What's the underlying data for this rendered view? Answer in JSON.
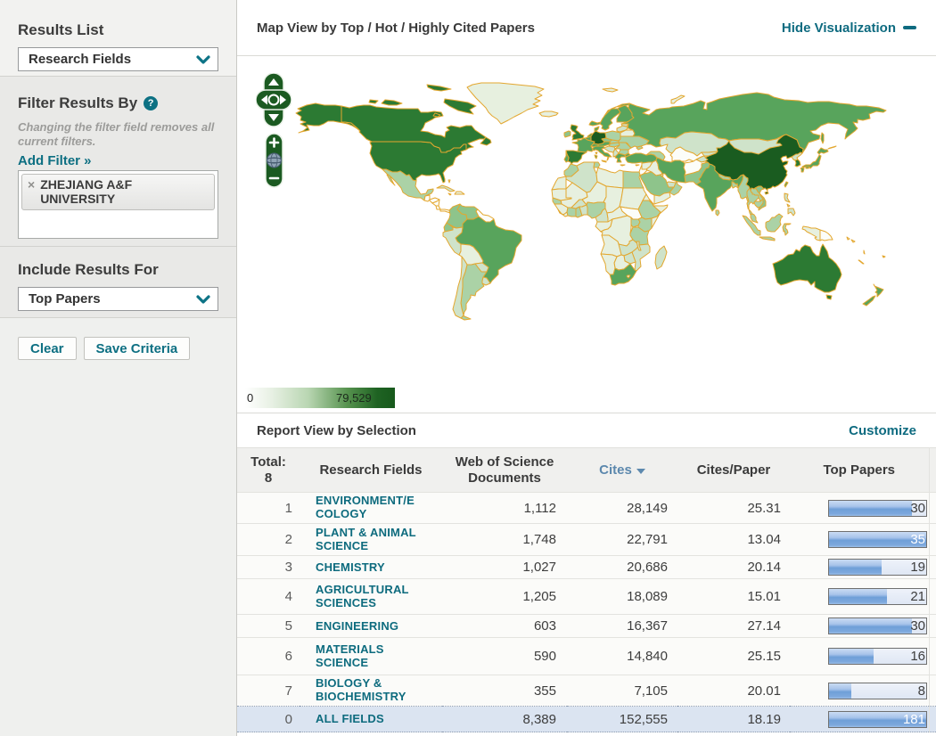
{
  "sidebar": {
    "results_list": {
      "label": "Results List",
      "value": "Research Fields"
    },
    "filter": {
      "heading": "Filter Results By",
      "help_icon": "?",
      "note": "Changing the filter field removes all current filters.",
      "add_filter": "Add Filter »",
      "chip": {
        "remove_icon": "×",
        "text": "ZHEJIANG A&F UNIVERSITY"
      }
    },
    "include": {
      "heading": "Include Results For",
      "value": "Top Papers"
    },
    "buttons": {
      "clear": "Clear",
      "save": "Save Criteria"
    }
  },
  "map": {
    "title": "Map View by Top / Hot / Highly Cited Papers",
    "hide_label": "Hide Visualization",
    "legend": {
      "min": "0",
      "max": "79,529"
    }
  },
  "report": {
    "title": "Report View by Selection",
    "customize_label": "Customize",
    "table": {
      "headers": {
        "total_line1": "Total:",
        "total_line2": "8",
        "fields": "Research Fields",
        "documents": "Web of Science Documents",
        "cites": "Cites",
        "cites_paper": "Cites/Paper",
        "top_papers": "Top Papers"
      },
      "rows": [
        {
          "rank": "1",
          "field": "ENVIRONMENT/ECOLOGY",
          "documents": "1,112",
          "cites": "28,149",
          "cites_per_paper": "25.31",
          "top_papers": 30,
          "highlight": false
        },
        {
          "rank": "2",
          "field": "PLANT & ANIMAL SCIENCE",
          "documents": "1,748",
          "cites": "22,791",
          "cites_per_paper": "13.04",
          "top_papers": 35,
          "highlight": false
        },
        {
          "rank": "3",
          "field": "CHEMISTRY",
          "documents": "1,027",
          "cites": "20,686",
          "cites_per_paper": "20.14",
          "top_papers": 19,
          "highlight": false
        },
        {
          "rank": "4",
          "field": "AGRICULTURAL SCIENCES",
          "documents": "1,205",
          "cites": "18,089",
          "cites_per_paper": "15.01",
          "top_papers": 21,
          "highlight": false
        },
        {
          "rank": "5",
          "field": "ENGINEERING",
          "documents": "603",
          "cites": "16,367",
          "cites_per_paper": "27.14",
          "top_papers": 30,
          "highlight": false
        },
        {
          "rank": "6",
          "field": "MATERIALS SCIENCE",
          "documents": "590",
          "cites": "14,840",
          "cites_per_paper": "25.15",
          "top_papers": 16,
          "highlight": false
        },
        {
          "rank": "7",
          "field": "BIOLOGY & BIOCHEMISTRY",
          "documents": "355",
          "cites": "7,105",
          "cites_per_paper": "20.01",
          "top_papers": 8,
          "highlight": false
        },
        {
          "rank": "0",
          "field": "ALL FIELDS",
          "documents": "8,389",
          "cites": "152,555",
          "cites_per_paper": "18.19",
          "top_papers": 181,
          "highlight": true
        }
      ]
    }
  },
  "colors": {
    "teal": "#0d6f82",
    "cites_header": "#5c88ad",
    "bar_fill": "#7ea9dd",
    "highlight_row": "#dbe4f1",
    "map_scale_dark": "#1a5c20",
    "map_border": "#e3a72f",
    "map_palette": [
      "#fcfdf9",
      "#e7f0df",
      "#cfe3ca",
      "#abd2a6",
      "#8ec48b",
      "#58a45c",
      "#2c7a33",
      "#1a5c20"
    ]
  }
}
